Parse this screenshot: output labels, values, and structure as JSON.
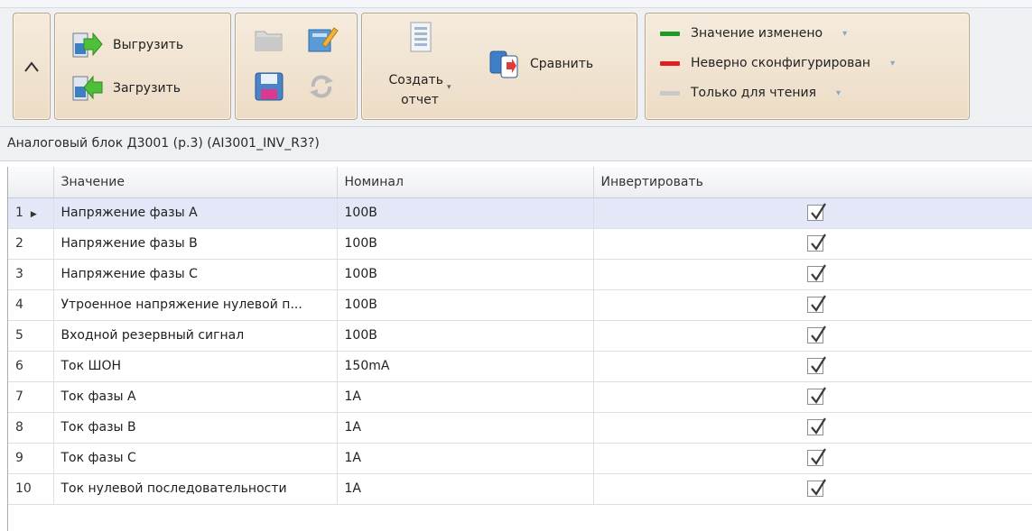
{
  "ribbon": {
    "collapse_glyph": "^",
    "export_label": "Выгрузить",
    "import_label": "Загрузить",
    "create_report_line1": "Создать",
    "create_report_line2": "отчет",
    "compare_label": "Сравнить",
    "legend": [
      {
        "label": "Значение изменено",
        "color": "#1e9a2a"
      },
      {
        "label": "Неверно сконфигурирован",
        "color": "#e02020"
      },
      {
        "label": "Только для чтения",
        "color": "#c8c8c8"
      }
    ]
  },
  "breadcrumb": "Аналоговый блок Д3001 (р.3) (AI3001_INV_R3?)",
  "table": {
    "columns": [
      "",
      "Значение",
      "Номинал",
      "Инвертировать"
    ],
    "rows": [
      {
        "n": "1",
        "value": "Напряжение фазы A",
        "nominal": "100В",
        "invert": true,
        "selected": true
      },
      {
        "n": "2",
        "value": "Напряжение фазы B",
        "nominal": "100В",
        "invert": true
      },
      {
        "n": "3",
        "value": "Напряжение фазы C",
        "nominal": "100В",
        "invert": true
      },
      {
        "n": "4",
        "value": "Утроенное напряжение нулевой п...",
        "nominal": "100В",
        "invert": true
      },
      {
        "n": "5",
        "value": "Входной резервный сигнал",
        "nominal": "100В",
        "invert": true
      },
      {
        "n": "6",
        "value": "Ток ШОН",
        "nominal": "150mA",
        "invert": true
      },
      {
        "n": "7",
        "value": "Ток фазы A",
        "nominal": "1A",
        "invert": true
      },
      {
        "n": "8",
        "value": "Ток фазы B",
        "nominal": "1A",
        "invert": true
      },
      {
        "n": "9",
        "value": "Ток фазы C",
        "nominal": "1A",
        "invert": true
      },
      {
        "n": "10",
        "value": "Ток нулевой последовательности",
        "nominal": "1A",
        "invert": true
      }
    ]
  }
}
